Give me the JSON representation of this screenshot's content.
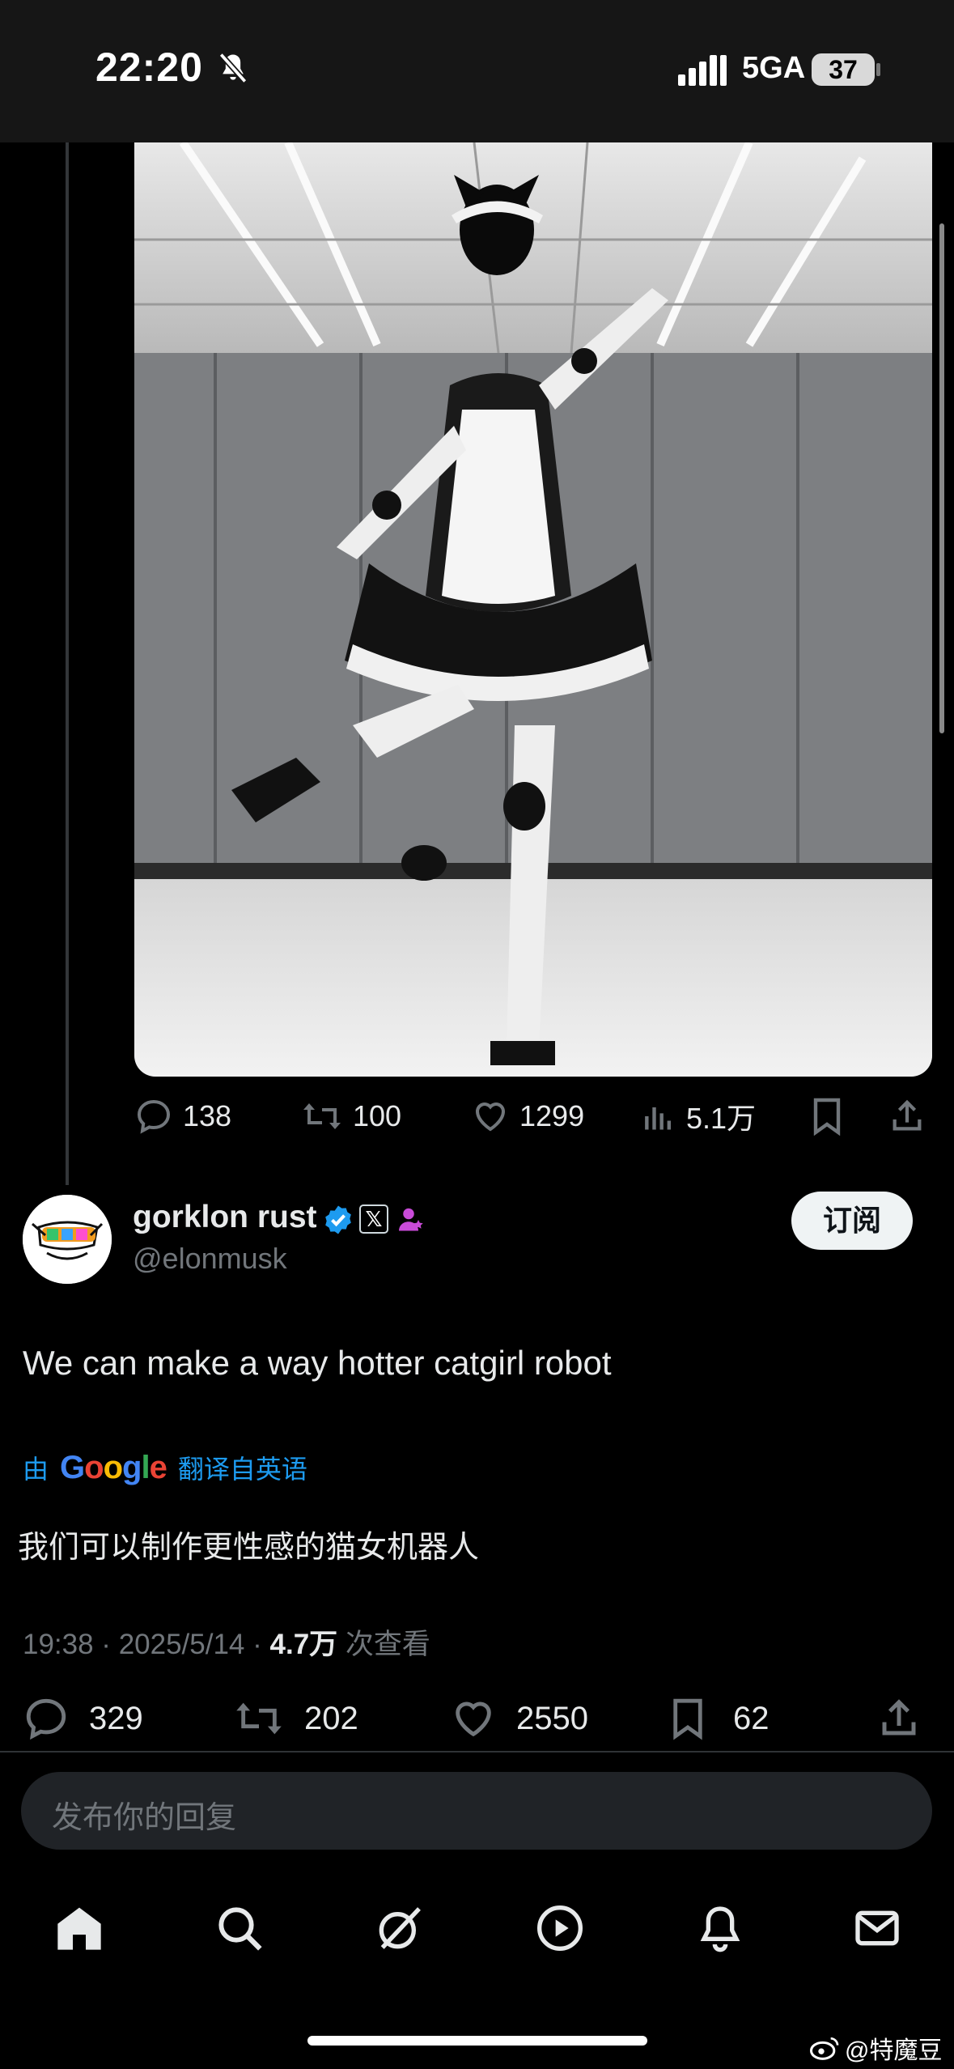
{
  "status_bar": {
    "time": "22:20",
    "network": "5GA",
    "battery": "37"
  },
  "upper_tweet": {
    "stats": {
      "replies": "138",
      "reposts": "100",
      "likes": "1299",
      "views": "5.1万"
    }
  },
  "author": {
    "name": "gorklon rust",
    "handle": "@elonmusk",
    "x_badge": "𝕏",
    "subscribe_label": "订阅"
  },
  "tweet": {
    "text": "We can make a way hotter catgirl robot",
    "translate_prefix": "由",
    "translate_brand": "Google",
    "translate_suffix": "翻译自英语",
    "translated_text": "我们可以制作更性感的猫女机器人",
    "time": "19:38 · 2025/5/14 · ",
    "views": "4.7万",
    "views_suffix": " 次查看"
  },
  "stats": {
    "replies": "329",
    "reposts": "202",
    "likes": "2550",
    "bookmarks": "62"
  },
  "reply_input": {
    "placeholder": "发布你的回复"
  },
  "tabs": [
    "home-icon",
    "search-icon",
    "grok-icon",
    "video-icon",
    "notifications-icon",
    "messages-icon"
  ],
  "watermark": "@特魔豆",
  "colors": {
    "background": "#000000",
    "accent": "#1d9bf0",
    "muted": "#71767b",
    "verified": "#1d9bf0"
  }
}
